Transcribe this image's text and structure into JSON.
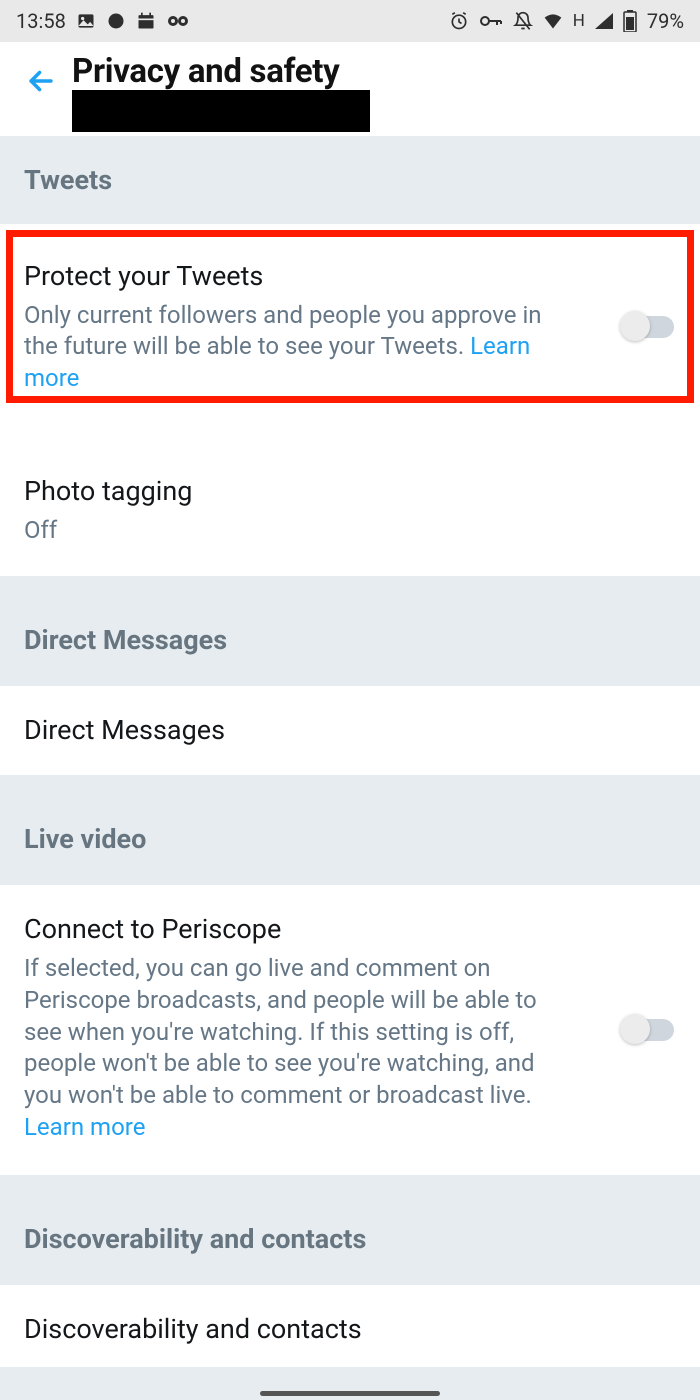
{
  "status": {
    "time": "13:58",
    "network": "H",
    "battery": "79%"
  },
  "header": {
    "title": "Privacy and safety"
  },
  "sections": {
    "tweets": "Tweets",
    "direct_messages": "Direct Messages",
    "live_video": "Live video",
    "discoverability": "Discoverability and contacts"
  },
  "items": {
    "protect_tweets": {
      "title": "Protect your Tweets",
      "desc": "Only current followers and people you approve in the future will be able to see your Tweets.",
      "learn_more": "Learn more"
    },
    "photo_tagging": {
      "title": "Photo tagging",
      "value": "Off"
    },
    "dm": {
      "title": "Direct Messages"
    },
    "periscope": {
      "title": "Connect to Periscope",
      "desc": "If selected, you can go live and comment on Periscope broadcasts, and people will be able to see when you're watching. If this setting is off, people won't be able to see you're watching, and you won't be able to comment or broadcast live.",
      "learn_more": "Learn more"
    },
    "discoverability_item": {
      "title": "Discoverability and contacts"
    }
  }
}
